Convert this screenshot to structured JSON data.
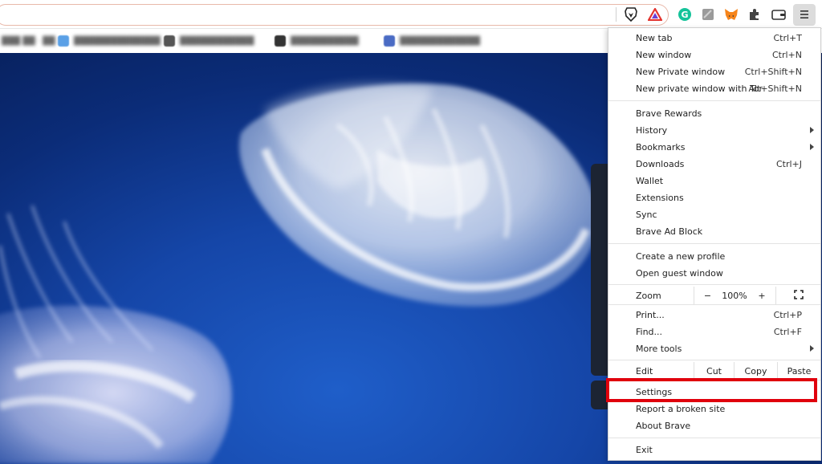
{
  "toolbar": {
    "icons": [
      "brave-lion-icon",
      "brave-rewards-triangle-icon",
      "grammarly-icon",
      "extension-square-icon",
      "metamask-fox-icon",
      "puzzle-extensions-icon",
      "wallet-icon",
      "hamburger-menu-icon"
    ]
  },
  "colors": {
    "highlight": "#e0000c",
    "brave_orange": "#fb542b",
    "grammarly_green": "#15c39a"
  },
  "menu": {
    "group1": [
      {
        "label": "New tab",
        "shortcut": "Ctrl+T"
      },
      {
        "label": "New window",
        "shortcut": "Ctrl+N"
      },
      {
        "label": "New Private window",
        "shortcut": "Ctrl+Shift+N"
      },
      {
        "label": "New private window with Tor",
        "shortcut": "Alt+Shift+N"
      }
    ],
    "group2": [
      {
        "label": "Brave Rewards",
        "shortcut": ""
      },
      {
        "label": "History",
        "shortcut": ""
      },
      {
        "label": "Bookmarks",
        "shortcut": ""
      },
      {
        "label": "Downloads",
        "shortcut": "Ctrl+J"
      },
      {
        "label": "Wallet",
        "shortcut": ""
      },
      {
        "label": "Extensions",
        "shortcut": ""
      },
      {
        "label": "Sync",
        "shortcut": ""
      },
      {
        "label": "Brave Ad Block",
        "shortcut": ""
      }
    ],
    "group3": [
      {
        "label": "Create a new profile"
      },
      {
        "label": "Open guest window"
      }
    ],
    "zoom": {
      "label": "Zoom",
      "minus": "−",
      "value": "100%",
      "plus": "+"
    },
    "group4": [
      {
        "label": "Print...",
        "shortcut": "Ctrl+P"
      },
      {
        "label": "Find...",
        "shortcut": "Ctrl+F"
      },
      {
        "label": "More tools",
        "shortcut": ""
      }
    ],
    "edit": {
      "label": "Edit",
      "cut": "Cut",
      "copy": "Copy",
      "paste": "Paste"
    },
    "group5": [
      {
        "label": "Settings"
      },
      {
        "label": "Report a broken site"
      },
      {
        "label": "About Brave"
      }
    ],
    "exit": {
      "label": "Exit"
    }
  }
}
